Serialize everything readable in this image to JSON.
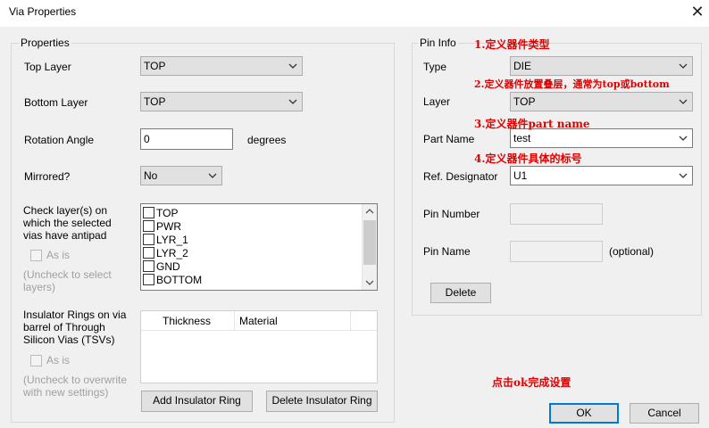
{
  "window": {
    "title": "Via Properties",
    "close_icon": "close-icon"
  },
  "properties": {
    "legend": "Properties",
    "top_layer": {
      "label": "Top Layer",
      "value": "TOP"
    },
    "bottom_layer": {
      "label": "Bottom Layer",
      "value": "TOP"
    },
    "rotation": {
      "label": "Rotation Angle",
      "value": "0",
      "unit": "degrees"
    },
    "mirrored": {
      "label": "Mirrored?",
      "value": "No"
    },
    "check_layers": {
      "label_lines": [
        "Check layer(s) on",
        "which the selected",
        "vias have antipad"
      ],
      "items": [
        "TOP",
        "PWR",
        "LYR_1",
        "LYR_2",
        "GND",
        "BOTTOM"
      ],
      "as_is": "As is",
      "hint_lines": [
        "(Uncheck to select",
        "layers)"
      ]
    },
    "insulator": {
      "label_lines": [
        "Insulator Rings on via",
        "barrel of Through",
        "Silicon Vias (TSVs)"
      ],
      "columns": [
        "Thickness",
        "Material"
      ],
      "as_is": "As is",
      "hint_lines": [
        "(Uncheck to overwrite",
        "with new settings)"
      ],
      "add_button": "Add Insulator Ring",
      "delete_button": "Delete Insulator Ring"
    }
  },
  "pin_info": {
    "legend": "Pin Info",
    "type": {
      "label": "Type",
      "value": "DIE"
    },
    "layer": {
      "label": "Layer",
      "value": "TOP"
    },
    "part_name": {
      "label": "Part Name",
      "value": "test"
    },
    "ref_designator": {
      "label": "Ref. Designator",
      "value": "U1"
    },
    "pin_number": {
      "label": "Pin Number",
      "value": ""
    },
    "pin_name": {
      "label": "Pin Name",
      "value": "",
      "note": "(optional)"
    },
    "delete_button": "Delete"
  },
  "annotations": {
    "a1": "1.定义器件类型",
    "a2": "2.定义器件放置叠层，通常为top或bottom",
    "a3": "3.定义器件part name",
    "a4": "4.定义器件具体的标号",
    "a5": "点击ok完成设置"
  },
  "footer": {
    "ok": "OK",
    "cancel": "Cancel"
  },
  "colors": {
    "annotation": "#e00000",
    "focus_border": "#0078d7"
  }
}
